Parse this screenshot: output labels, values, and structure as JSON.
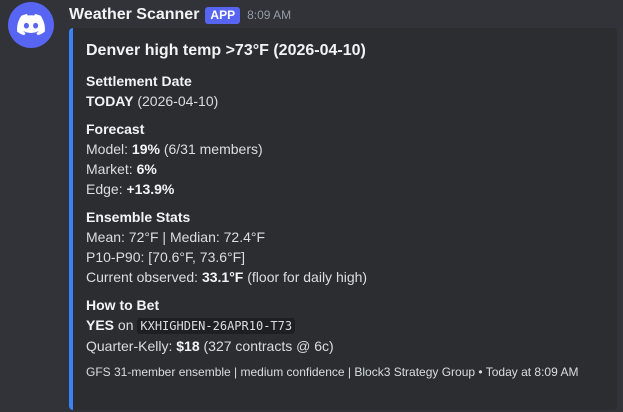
{
  "bot": {
    "name": "Weather Scanner",
    "badge": "APP",
    "timestamp": "8:09 AM",
    "avatar_icon": "discord-logo-icon"
  },
  "colors": {
    "background": "#313338",
    "embed_background": "#2b2d31",
    "embed_accent": "#3b82f6",
    "badge": "#5865f2"
  },
  "embed": {
    "title": "Denver high temp >73°F (2026-04-10)",
    "settlement": {
      "name": "Settlement Date",
      "value_bold": "TODAY",
      "value_rest": " (2026-04-10)"
    },
    "forecast": {
      "name": "Forecast",
      "model_label": "Model: ",
      "model_value": "19%",
      "model_detail": " (6/31 members)",
      "market_label": "Market: ",
      "market_value": "6%",
      "edge_label": "Edge: ",
      "edge_value": "+13.9%"
    },
    "ensemble": {
      "name": "Ensemble Stats",
      "mean_median": "Mean: 72°F | Median: 72.4°F",
      "p10_p90": "P10-P90: [70.6°F, 73.6°F]",
      "observed_label": "Current observed: ",
      "observed_value": "33.1°F",
      "observed_note": " (floor for daily high)"
    },
    "how_to_bet": {
      "name": "How to Bet",
      "side": "YES",
      "on_text": " on ",
      "ticker": "KXHIGHDEN-26APR10-T73",
      "kelly_label": "Quarter-Kelly: ",
      "kelly_value": "$18",
      "kelly_detail": " (327 contracts @ 6c)"
    },
    "footer": "GFS 31-member ensemble | medium confidence | Block3 Strategy Group • Today at 8:09 AM"
  }
}
